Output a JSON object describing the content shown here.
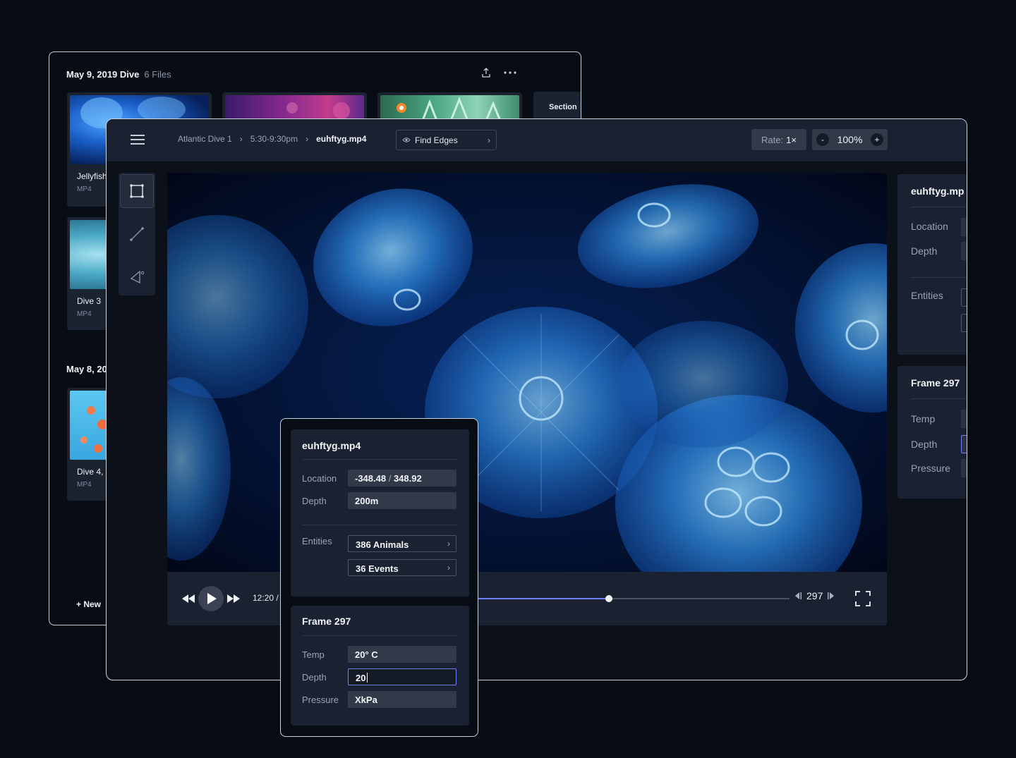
{
  "browser": {
    "group1": {
      "title": "May 9, 2019 Dive",
      "count": "6 Files"
    },
    "files": [
      {
        "name": "Jellyfish",
        "type": "MP4"
      },
      {
        "name": "Dive 3",
        "type": "MP4"
      },
      {
        "name": "Dive 4,",
        "type": "MP4"
      }
    ],
    "section_label": "Section",
    "group2_title": "May 8, 20",
    "new_label": "+ New"
  },
  "editor": {
    "breadcrumb": [
      "Atlantic Dive 1",
      "5:30-9:30pm",
      "euhftyg.mp4"
    ],
    "filter": {
      "label": "Find Edges",
      "icon": "eye-icon"
    },
    "rate": {
      "label": "Rate:",
      "value": "1×"
    },
    "zoom": {
      "minus": "-",
      "value": "100%",
      "plus": "+"
    },
    "tools": [
      "rectangle-select-icon",
      "line-tool-icon",
      "angle-tool-icon"
    ],
    "player": {
      "time": "12:20 /",
      "progress": 0.42,
      "frame": "297"
    }
  },
  "side_panel": {
    "file_title": "euhftyg.mp",
    "labels": {
      "location": "Location",
      "depth": "Depth",
      "entities": "Entities"
    },
    "frame_title": "Frame 297",
    "frame_labels": {
      "temp": "Temp",
      "depth": "Depth",
      "pressure": "Pressure"
    }
  },
  "popup": {
    "file_title": "euhftyg.mp4",
    "location_label": "Location",
    "location_x": "-348.48",
    "location_sep": " / ",
    "location_y": "348.92",
    "depth_label": "Depth",
    "depth_value": "200m",
    "entities_label": "Entities",
    "entities": [
      "386 Animals",
      "36 Events"
    ],
    "frame_title": "Frame 297",
    "temp_label": "Temp",
    "temp_value": "20° C",
    "frame_depth_label": "Depth",
    "frame_depth_value": "20",
    "pressure_label": "Pressure",
    "pressure_value": "XkPa"
  },
  "colors": {
    "accent": "#6f7fff",
    "panel": "#1a2130",
    "background": "#070b14"
  }
}
